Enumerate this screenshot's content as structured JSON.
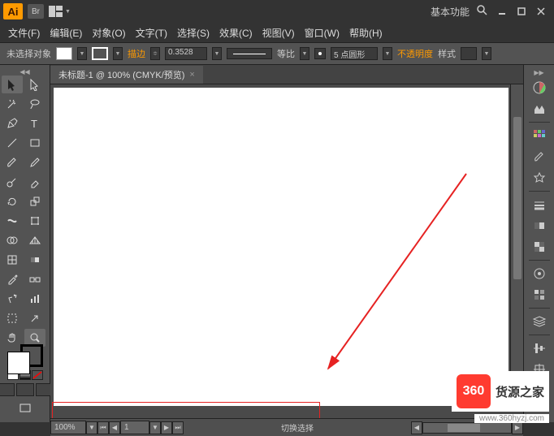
{
  "title": {
    "app": "Ai",
    "bridge": "Br",
    "workspace": "基本功能"
  },
  "menu": {
    "file": "文件(F)",
    "edit": "编辑(E)",
    "object": "对象(O)",
    "type": "文字(T)",
    "select": "选择(S)",
    "effect": "效果(C)",
    "view": "视图(V)",
    "window": "窗口(W)",
    "help": "帮助(H)"
  },
  "control": {
    "noSelection": "未选择对象",
    "strokeLabel": "描边",
    "strokeWeight": "0.3528",
    "uniform": "等比",
    "profile": "5 点圆形",
    "opacity": "不透明度",
    "styleLabel": "样式"
  },
  "document": {
    "tab": "未标题-1 @ 100% (CMYK/预览)"
  },
  "status": {
    "zoom": "100%",
    "page": "1",
    "selToggle": "切换选择"
  },
  "watermark": {
    "logo": "360",
    "name": "货源之家",
    "url": "www.360hyzj.com"
  }
}
